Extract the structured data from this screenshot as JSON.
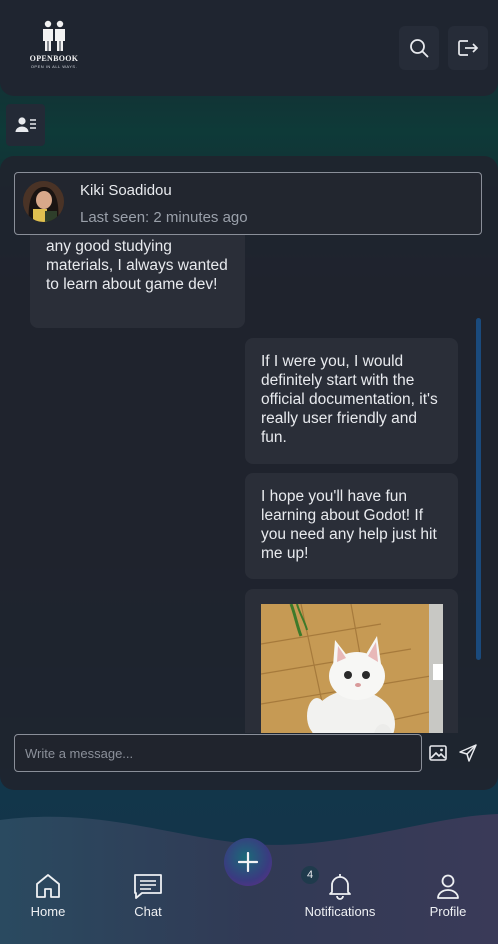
{
  "app": {
    "logo_text": "OPENBOOK",
    "logo_tagline": "OPEN IN ALL WAYS."
  },
  "header": {
    "search_icon": "search-icon",
    "logout_icon": "logout-icon",
    "contacts_icon": "contacts-list-icon"
  },
  "contact": {
    "name": "Kiki Soadidou",
    "last_seen": "Last seen: 2 minutes ago"
  },
  "messages": [
    {
      "from": "contact",
      "text": "any good studying materials, I always wanted to learn about game dev!"
    },
    {
      "from": "me",
      "text": "If I were you, I would definitely start with the official documentation, it's really user friendly and fun."
    },
    {
      "from": "me",
      "text": "I hope you'll have fun learning about Godot! If you need any help just hit me up!"
    },
    {
      "from": "me",
      "type": "image",
      "image": "white-cat-photo"
    }
  ],
  "composer": {
    "placeholder": "Write a message...",
    "image_icon": "image-icon",
    "send_icon": "send-icon"
  },
  "nav": {
    "home": "Home",
    "chat": "Chat",
    "notifications": "Notifications",
    "notifications_count": "4",
    "profile": "Profile",
    "add_icon": "plus-icon"
  },
  "colors": {
    "accent_scroll": "#1a4a7c",
    "panel": "#20242e",
    "bubble": "#2a2e38"
  }
}
